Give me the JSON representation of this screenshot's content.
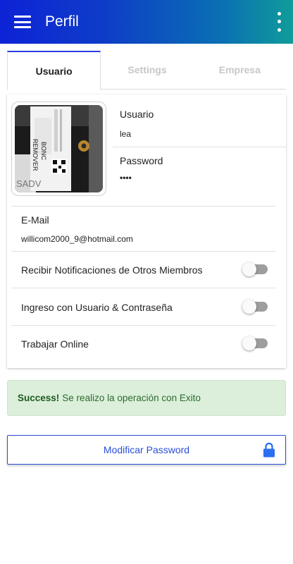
{
  "appbar": {
    "title": "Perfil",
    "menu_icon": "hamburger-menu-icon",
    "more_icon": "more-vert-icon",
    "gradient": [
      "#0d23d6",
      "#109c9a"
    ]
  },
  "tabs": [
    {
      "label": "Usuario",
      "active": true
    },
    {
      "label": "Settings",
      "active": false
    },
    {
      "label": "Empresa",
      "active": false
    }
  ],
  "profile": {
    "usuario_label": "Usuario",
    "usuario_value": "lea",
    "password_label": "Password",
    "password_value": "••••",
    "email_label": "E-Mail",
    "email_value": "willicom2000_9@hotmail.com",
    "photo_text": [
      "REMOVER",
      "BONC",
      "SADV"
    ]
  },
  "settings": [
    {
      "label": "Recibir Notificaciones de Otros Miembros",
      "enabled": false
    },
    {
      "label": "Ingreso con Usuario & Contraseña",
      "enabled": false
    },
    {
      "label": "Trabajar Online",
      "enabled": false
    }
  ],
  "alert": {
    "strong": "Success!",
    "text": "Se realizo la operación con Exito",
    "color": "#dbefda"
  },
  "button": {
    "label": "Modificar Password",
    "icon": "lock-icon",
    "color": "#2a4fd8"
  }
}
